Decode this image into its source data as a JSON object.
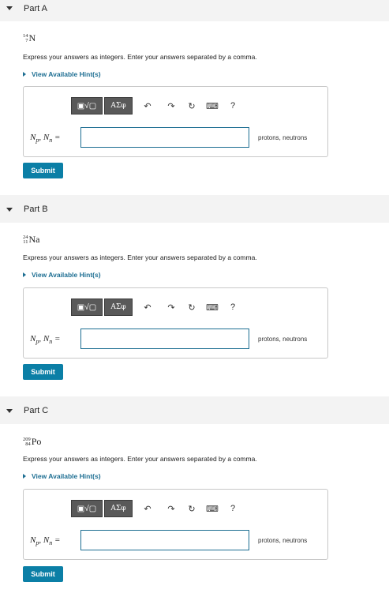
{
  "parts": [
    {
      "title": "Part A",
      "nuclide": {
        "mass": "14",
        "atomic": "7",
        "symbol": "N"
      },
      "instructions": "Express your answers as integers. Enter your answers separated by a comma.",
      "hint": "View Available Hint(s)",
      "toolbar": {
        "templates": "▣√▢",
        "symbols": "ΑΣφ",
        "undo": "↶",
        "redo": "↷",
        "reset": "↻",
        "keyboard": "⌨",
        "help": "?"
      },
      "answer_label": "N_p, N_n =",
      "answer_value": "",
      "units": "protons, neutrons",
      "submit": "Submit"
    },
    {
      "title": "Part B",
      "nuclide": {
        "mass": "24",
        "atomic": "11",
        "symbol": "Na"
      },
      "instructions": "Express your answers as integers. Enter your answers separated by a comma.",
      "hint": "View Available Hint(s)",
      "toolbar": {
        "templates": "▣√▢",
        "symbols": "ΑΣφ",
        "undo": "↶",
        "redo": "↷",
        "reset": "↻",
        "keyboard": "⌨",
        "help": "?"
      },
      "answer_label": "N_p, N_n =",
      "answer_value": "",
      "units": "protons, neutrons",
      "submit": "Submit"
    },
    {
      "title": "Part C",
      "nuclide": {
        "mass": "209",
        "atomic": "84",
        "symbol": "Po"
      },
      "instructions": "Express your answers as integers. Enter your answers separated by a comma.",
      "hint": "View Available Hint(s)",
      "toolbar": {
        "templates": "▣√▢",
        "symbols": "ΑΣφ",
        "undo": "↶",
        "redo": "↷",
        "reset": "↻",
        "keyboard": "⌨",
        "help": "?"
      },
      "answer_label": "N_p, N_n =",
      "answer_value": "",
      "units": "protons, neutrons",
      "submit": "Submit"
    }
  ]
}
